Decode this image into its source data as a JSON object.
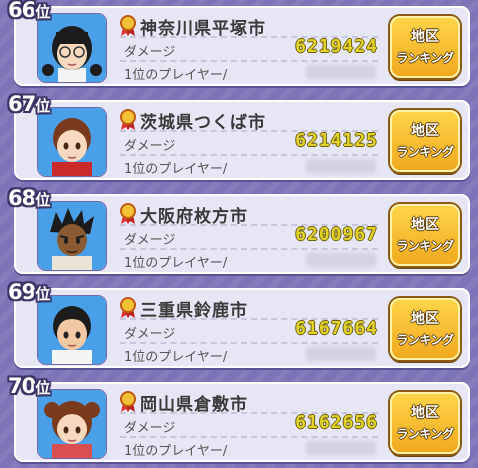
{
  "rows": [
    {
      "rank": "66",
      "rank_unit": "位",
      "city": "神奈川県平塚市",
      "damage_label": "ダメージ",
      "damage": "6219424",
      "player_label": "1位のプレイヤー/",
      "button_line1": "地区",
      "button_line2": "ランキング",
      "avatar": "girl-black-pigtails-glasses"
    },
    {
      "rank": "67",
      "rank_unit": "位",
      "city": "茨城県つくば市",
      "damage_label": "ダメージ",
      "damage": "6214125",
      "player_label": "1位のプレイヤー/",
      "button_line1": "地区",
      "button_line2": "ランキング",
      "avatar": "boy-red-hair"
    },
    {
      "rank": "68",
      "rank_unit": "位",
      "city": "大阪府枚方市",
      "damage_label": "ダメージ",
      "damage": "6200967",
      "player_label": "1位のプレイヤー/",
      "button_line1": "地区",
      "button_line2": "ランキング",
      "avatar": "boy-dark-spiky"
    },
    {
      "rank": "69",
      "rank_unit": "位",
      "city": "三重県鈴鹿市",
      "damage_label": "ダメージ",
      "damage": "6167664",
      "player_label": "1位のプレイヤー/",
      "button_line1": "地区",
      "button_line2": "ランキング",
      "avatar": "boy-black-hair"
    },
    {
      "rank": "70",
      "rank_unit": "位",
      "city": "岡山県倉敷市",
      "damage_label": "ダメージ",
      "damage": "6162656",
      "player_label": "1位のプレイヤー/",
      "button_line1": "地区",
      "button_line2": "ランキング",
      "avatar": "girl-brown-buns"
    }
  ],
  "colors": {
    "accent_damage": "#e2d22a",
    "button": "#f0a81e",
    "background": "#7d74b8"
  }
}
